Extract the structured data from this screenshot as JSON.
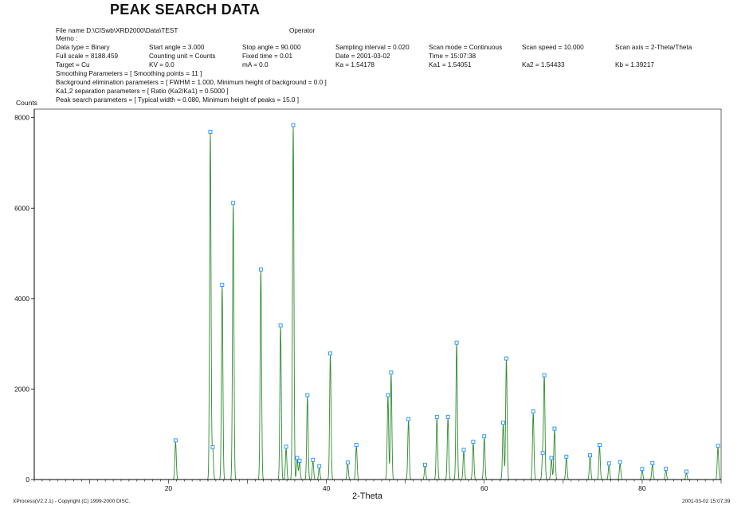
{
  "title": "PEAK SEARCH DATA",
  "header": {
    "file_name": "File name   D:\\CISwb\\XRD2000\\Data\\TEST",
    "operator": "Operator",
    "memo": "Memo :",
    "row1": [
      "Data type = Binary",
      "Start angle = 3.000",
      "Stop angle = 90.000",
      "Sampling interval = 0.020",
      "Scan mode = Continuous",
      "Scan speed = 10.000",
      "Scan axis = 2-Theta/Theta"
    ],
    "row2": [
      "Full scale = 8188.459",
      "Counting unit = Counts",
      "Fixed time = 0.01",
      "Date = 2001-03-02",
      "Time = 15:07:38"
    ],
    "row3": [
      "Target = Cu",
      "KV = 0.0",
      "mA = 0.0",
      "Ka = 1.54178",
      "Ka1 = 1.54051",
      "Ka2 = 1.54433",
      "Kb = 1.39217"
    ],
    "smoothing": "Smoothing Parameters = [ Smoothing points = 11 ]",
    "background": "Background elimination parameters = [ FWHM = 1.000,  Minimum height of background = 0.0 ]",
    "ka_sep": "Ka1,2 separation parameters = [ Ratio (Ka2/Ka1) = 0.5000 ]",
    "peak_search": "Peak search parameters = [ Typical width = 0.080,  Minimum height of peaks = 15.0 ]"
  },
  "footer": {
    "left": "XProcess(V2.2.1) - Copyright (C) 1999-2000 DISC.",
    "right": "2001-03-02  15:07:39"
  },
  "colors": {
    "trace": "#2e8b2e",
    "marker": "#1e90ff",
    "axis": "#000000"
  },
  "chart_data": {
    "type": "line",
    "title": "PEAK SEARCH DATA",
    "xlabel": "2-Theta",
    "ylabel": "Counts",
    "xlim": [
      3,
      90
    ],
    "ylim": [
      0,
      8188.459
    ],
    "xticks": [
      20,
      40,
      60,
      80
    ],
    "yticks": [
      0,
      2000,
      4000,
      6000,
      8000
    ],
    "grid": false,
    "peaks": [
      {
        "x": 20.9,
        "y": 830
      },
      {
        "x": 25.3,
        "y": 7650
      },
      {
        "x": 25.6,
        "y": 680
      },
      {
        "x": 26.8,
        "y": 4270
      },
      {
        "x": 28.2,
        "y": 6080
      },
      {
        "x": 31.7,
        "y": 4610
      },
      {
        "x": 34.2,
        "y": 3370
      },
      {
        "x": 34.9,
        "y": 690
      },
      {
        "x": 35.8,
        "y": 7800
      },
      {
        "x": 36.3,
        "y": 440
      },
      {
        "x": 36.6,
        "y": 380
      },
      {
        "x": 37.6,
        "y": 1830
      },
      {
        "x": 38.3,
        "y": 400
      },
      {
        "x": 39.1,
        "y": 260
      },
      {
        "x": 40.5,
        "y": 2750
      },
      {
        "x": 42.7,
        "y": 340
      },
      {
        "x": 43.8,
        "y": 730
      },
      {
        "x": 47.8,
        "y": 1830
      },
      {
        "x": 48.2,
        "y": 2330
      },
      {
        "x": 50.4,
        "y": 1300
      },
      {
        "x": 52.5,
        "y": 290
      },
      {
        "x": 54.0,
        "y": 1350
      },
      {
        "x": 55.4,
        "y": 1350
      },
      {
        "x": 56.5,
        "y": 2990
      },
      {
        "x": 57.4,
        "y": 620
      },
      {
        "x": 58.6,
        "y": 800
      },
      {
        "x": 60.0,
        "y": 920
      },
      {
        "x": 62.4,
        "y": 1220
      },
      {
        "x": 62.8,
        "y": 2640
      },
      {
        "x": 66.2,
        "y": 1470
      },
      {
        "x": 67.4,
        "y": 550
      },
      {
        "x": 67.6,
        "y": 2270
      },
      {
        "x": 68.5,
        "y": 440
      },
      {
        "x": 68.9,
        "y": 1090
      },
      {
        "x": 70.4,
        "y": 470
      },
      {
        "x": 73.4,
        "y": 500
      },
      {
        "x": 74.6,
        "y": 730
      },
      {
        "x": 75.8,
        "y": 320
      },
      {
        "x": 77.2,
        "y": 350
      },
      {
        "x": 80.0,
        "y": 200
      },
      {
        "x": 81.3,
        "y": 330
      },
      {
        "x": 83.0,
        "y": 200
      },
      {
        "x": 85.6,
        "y": 140
      },
      {
        "x": 89.6,
        "y": 710
      }
    ]
  }
}
